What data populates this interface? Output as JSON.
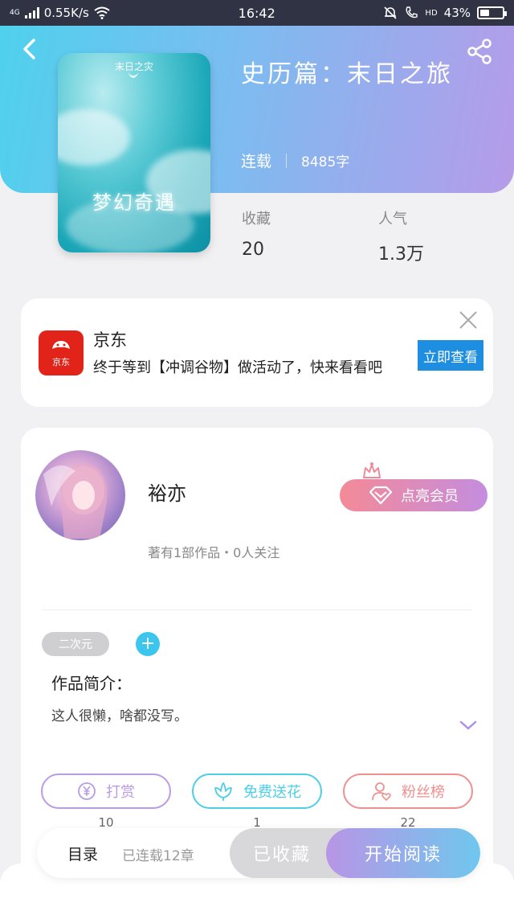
{
  "status_bar": {
    "network": "4G",
    "speed": "0.55K/s",
    "time": "16:42",
    "hd": "HD",
    "battery": "43%",
    "battery_level": 0.43
  },
  "book": {
    "title": "史历篇：末日之旅",
    "status": "连载",
    "word_count": "8485字",
    "cover_top_text": "末日之灾",
    "cover_main_text": "梦幻奇遇",
    "stats": [
      {
        "label": "收藏",
        "value": "20"
      },
      {
        "label": "人气",
        "value": "1.3万"
      }
    ]
  },
  "ad": {
    "logo_text": "京东",
    "title": "京东",
    "description": "终于等到【冲调谷物】做活动了，快来看看吧",
    "button_label": "立即查看"
  },
  "author": {
    "name": "裕亦",
    "summary": "著有1部作品・0人关注",
    "vip_label": "点亮会员",
    "tag": "二次元",
    "add_tag": "+",
    "intro_label": "作品简介：",
    "intro_text": "这人很懒，啥都没写。"
  },
  "actions": [
    {
      "label": "打赏",
      "count": "10",
      "color": "#b99be6"
    },
    {
      "label": "免费送花",
      "count": "1",
      "color": "#4ccfe6"
    },
    {
      "label": "粉丝榜",
      "count": "22",
      "color": "#ef8f8f"
    }
  ],
  "bottom": {
    "toc_label": "目录",
    "toc_sub": "已连载12章",
    "fav_label": "已收藏",
    "read_label": "开始阅读"
  }
}
